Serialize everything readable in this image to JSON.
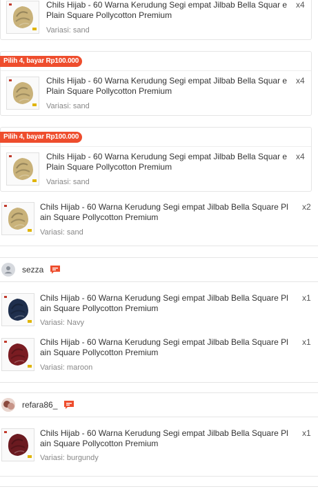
{
  "items": [
    {
      "title": "Chils Hijab - 60 Warna Kerudung Segi empat Jilbab Bella Squar e Plain Square Pollycotton Premium",
      "qty": "x4",
      "variant": "Variasi: sand",
      "color": "#c9b27a"
    },
    {
      "promo": "Pilih 4, bayar Rp100.000",
      "title": "Chils Hijab - 60 Warna Kerudung Segi empat Jilbab Bella Squar e Plain Square Pollycotton Premium",
      "qty": "x4",
      "variant": "Variasi: sand",
      "color": "#c9b27a"
    },
    {
      "promo": "Pilih 4, bayar Rp100.000",
      "title": "Chils Hijab - 60 Warna Kerudung Segi empat Jilbab Bella Squar e Plain Square Pollycotton Premium",
      "qty": "x4",
      "variant": "Variasi: sand",
      "color": "#c9b27a"
    },
    {
      "title": "Chils Hijab - 60 Warna Kerudung Segi empat Jilbab Bella Square Pl ain Square Pollycotton Premium",
      "qty": "x2",
      "variant": "Variasi: sand",
      "color": "#c9b27a"
    }
  ],
  "sellers": [
    {
      "name": "sezza",
      "items": [
        {
          "title": "Chils Hijab - 60 Warna Kerudung Segi empat Jilbab Bella Square Pl ain Square Pollycotton Premium",
          "qty": "x1",
          "variant": "Variasi: Navy",
          "color": "#1f2f4d"
        },
        {
          "title": "Chils Hijab - 60 Warna Kerudung Segi empat Jilbab Bella Square Pl ain Square Pollycotton Premium",
          "qty": "x1",
          "variant": "Variasi: maroon",
          "color": "#7a1c22"
        }
      ]
    },
    {
      "name": "refara86_",
      "items": [
        {
          "title": "Chils Hijab - 60 Warna Kerudung Segi empat Jilbab Bella Square Pl ain Square Pollycotton Premium",
          "qty": "x1",
          "variant": "Variasi: burgundy",
          "color": "#6b1a20"
        }
      ]
    }
  ],
  "colors": {
    "accent": "#ee4d2d",
    "border": "#e5e5e5"
  },
  "icons": {
    "chat": "chat-icon",
    "avatar": "avatar-icon"
  }
}
